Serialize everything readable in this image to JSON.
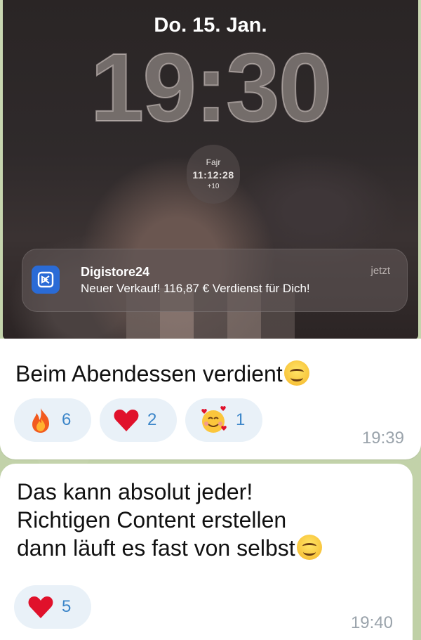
{
  "lockscreen": {
    "date": "Do. 15. Jan.",
    "time": "19:30",
    "widget": {
      "label": "Fajr",
      "countdown": "11:12:28",
      "sub": "+10"
    },
    "notification": {
      "app": "Digistore24",
      "message": "Neuer Verkauf! 116,87 € Verdienst für Dich!",
      "time": "jetzt",
      "icon": "digistore24-app-icon",
      "icon_color": "#2a6bd6"
    }
  },
  "messages": [
    {
      "text": "Beim Abendessen verdient",
      "emoji": "smiling-face-emoji",
      "time": "19:39",
      "reactions": [
        {
          "icon": "fire-emoji",
          "count": "6"
        },
        {
          "icon": "red-heart-emoji",
          "count": "2"
        },
        {
          "icon": "smiling-face-with-hearts-emoji",
          "count": "1"
        }
      ]
    },
    {
      "text": "Das kann absolut jeder!\nRichtigen Content erstellen\ndann läuft es fast von selbst",
      "emoji": "smiling-face-emoji",
      "time": "19:40",
      "reactions": [
        {
          "icon": "red-heart-emoji",
          "count": "5"
        }
      ]
    }
  ],
  "colors": {
    "reaction_count": "#3c86c9",
    "reaction_bg": "#e9f1f8",
    "time": "#9aa3ab"
  }
}
